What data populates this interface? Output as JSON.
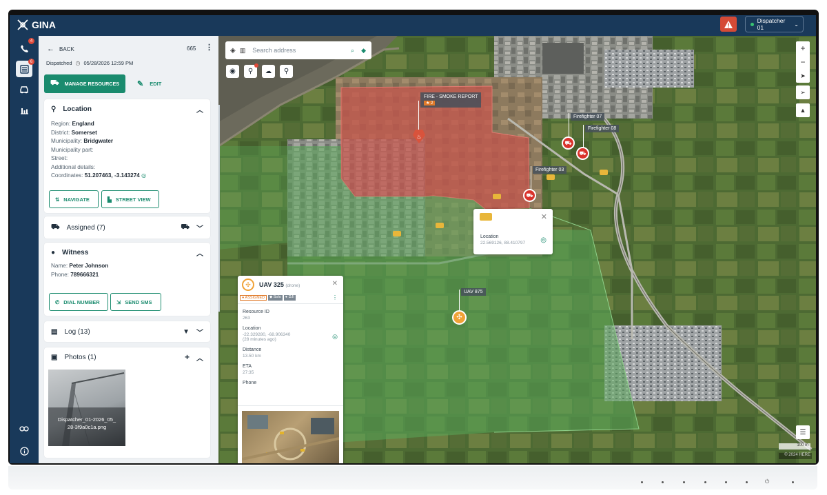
{
  "app": {
    "name": "GINA"
  },
  "header": {
    "dispatcher": "Dispatcher 01"
  },
  "rail": {
    "calls_badge": "4",
    "incidents_badge": "6"
  },
  "incident": {
    "back_label": "BACK",
    "number": "665",
    "status": "Dispatched",
    "datetime": "05/28/2026 12:59 PM",
    "manage_label": "MANAGE RESOURCES",
    "edit_label": "EDIT"
  },
  "location": {
    "title": "Location",
    "region_label": "Region:",
    "region": "England",
    "district_label": "District:",
    "district": "Somerset",
    "municipality_label": "Municipality:",
    "municipality": "Bridgwater",
    "municipality_part_label": "Municipality part:",
    "street_label": "Street:",
    "additional_label": "Additional details:",
    "coordinates_label": "Coordinates:",
    "coordinates": "51.207463, -3.143274",
    "navigate_label": "NAVIGATE",
    "street_view_label": "STREET VIEW"
  },
  "assigned": {
    "title": "Assigned (7)"
  },
  "witness": {
    "title": "Witness",
    "name_label": "Name:",
    "name": "Peter Johnson",
    "phone_label": "Phone:",
    "phone": "789666321",
    "dial_label": "DIAL NUMBER",
    "sms_label": "SEND SMS"
  },
  "log": {
    "title": "Log (13)"
  },
  "photos": {
    "title": "Photos (1)",
    "caption": "Dispatcher_01-2026_05_28-3f9a0c1a.png"
  },
  "map": {
    "search_placeholder": "Search address",
    "fire_label": "FIRE - SMOKE REPORT",
    "fire_badge": "2",
    "ff07": "Firefighter 07",
    "ff08": "Firefighter 08",
    "ff03": "Firefighter 03",
    "uav875": "UAV 875",
    "scale": "100 m",
    "copyright": "© 2024 HERE"
  },
  "camera_popup": {
    "location_label": "Location",
    "location_value": "22.569126, 88.410797"
  },
  "uav_popup": {
    "title": "UAV 325",
    "subtitle": "(drone)",
    "tag_assigned": "ASSIGNED",
    "tag_solo": "Solo",
    "tag_dji": "DJI",
    "resource_id_label": "Resource ID",
    "resource_id": "263",
    "location_label": "Location",
    "location_value": "-22.329280, -68.906340",
    "location_age": "(28 minutes ago)",
    "distance_label": "Distance",
    "distance": "13.50 km",
    "eta_label": "ETA",
    "eta": "27:35",
    "phone_label": "Phone"
  },
  "colors": {
    "navy": "#19395a",
    "accent": "#1a8b6e",
    "alert": "#d54a36",
    "fire_zone": "#c8544c",
    "green_zone": "#5aa85a"
  }
}
